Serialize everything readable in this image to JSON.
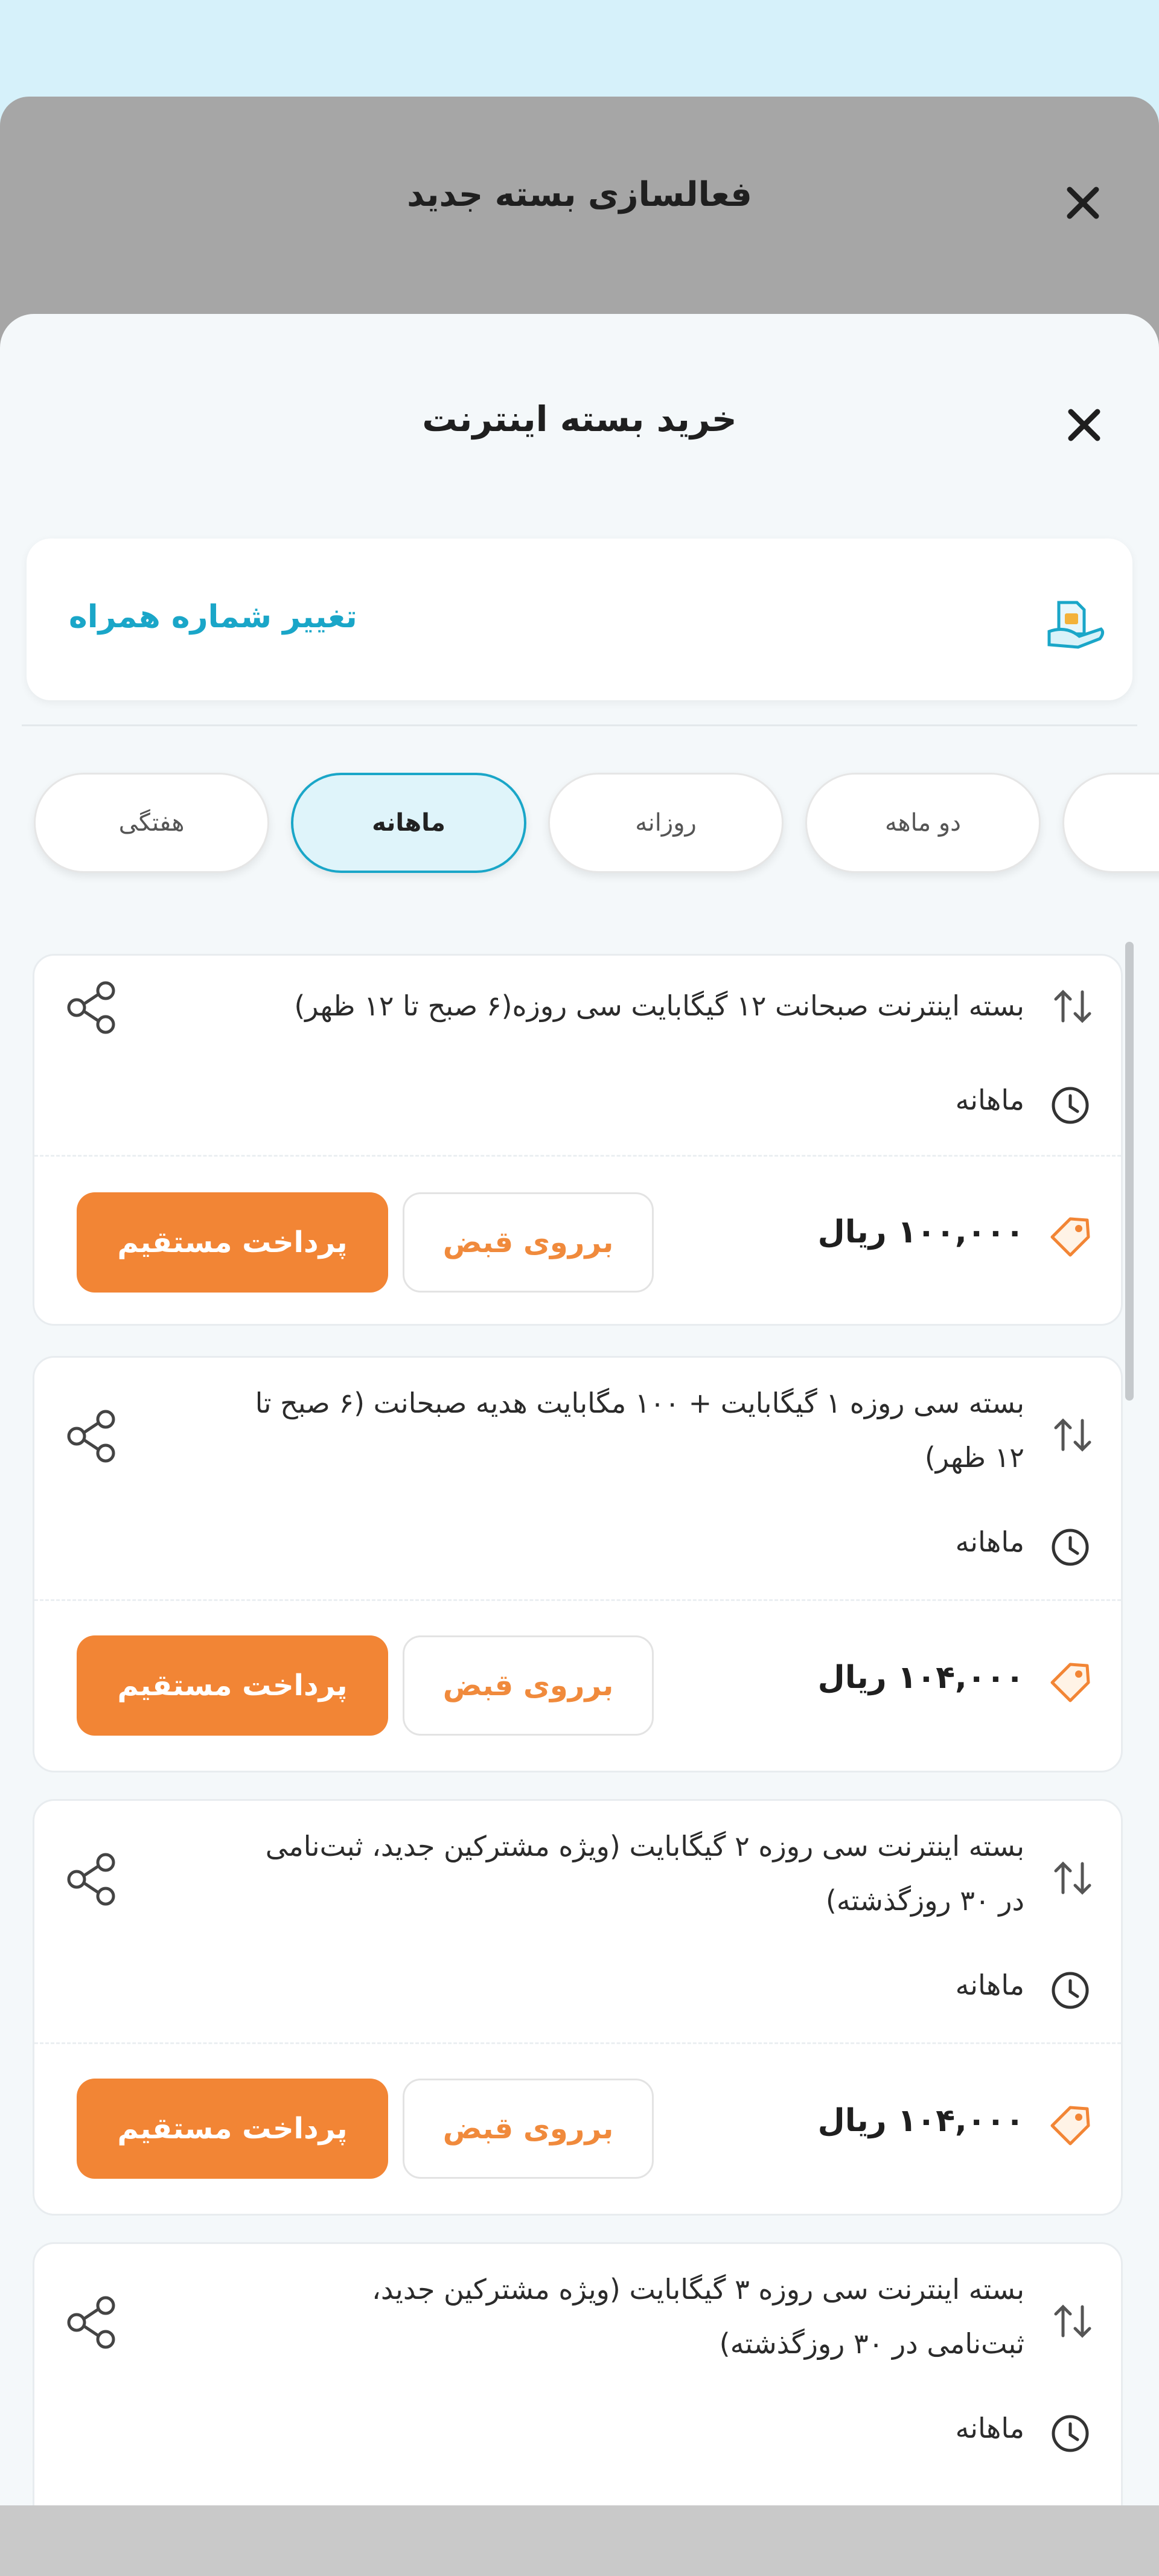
{
  "backdrop": {
    "title": "فعالسازی بسته جدید"
  },
  "sheet": {
    "title": "خرید بسته اینترنت"
  },
  "phone": {
    "link_label": "تغییر شماره همراه"
  },
  "chips": [
    {
      "label": "هفتگی"
    },
    {
      "label": "ماهانه",
      "active": true
    },
    {
      "label": "روزانه"
    },
    {
      "label": "دو ماهه"
    }
  ],
  "actions": {
    "bill_label": "برروی قبض",
    "pay_label": "پرداخت مستقیم"
  },
  "packages": [
    {
      "title_lines": [
        "بسته اینترنت صبحانت ۱۲ گیگابایت سی روزه(۶ صبح تا ۱۲ ظهر)"
      ],
      "period": "ماهانه",
      "price": "۱۰۰,۰۰۰ ریال"
    },
    {
      "title_lines": [
        "بسته سی روزه ۱ گیگابایت + ۱۰۰ مگابایت هدیه صبحانت (۶ صبح تا",
        "۱۲ ظهر)"
      ],
      "period": "ماهانه",
      "price": "۱۰۴,۰۰۰ ریال"
    },
    {
      "title_lines": [
        "بسته اینترنت سی روزه ۲ گیگابایت (ویژه مشترکین جدید، ثبت‌نامی",
        "در ۳۰ روزگذشته)"
      ],
      "period": "ماهانه",
      "price": "۱۰۴,۰۰۰ ریال"
    },
    {
      "title_lines": [
        "بسته اینترنت سی روزه ۳ گیگابایت (ویژه مشترکین جدید،",
        "ثبت‌نامی در ۳۰ روزگذشته)"
      ],
      "period": "ماهانه",
      "price": ""
    }
  ],
  "colors": {
    "accent": "#1aa6c8",
    "primary_button": "#f28535",
    "top_strip": "#d6f1fa",
    "backdrop": "#a6a6a6"
  },
  "icons": [
    "close-icon",
    "sim-card-icon",
    "sort-arrows-icon",
    "share-icon",
    "clock-icon",
    "price-tag-icon"
  ]
}
